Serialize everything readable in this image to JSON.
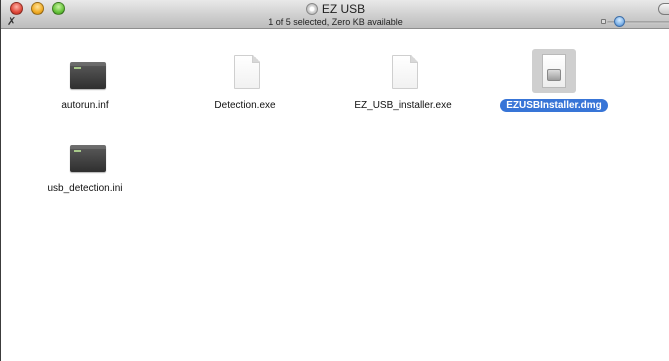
{
  "window": {
    "title": "EZ USB",
    "status": "1 of 5 selected, Zero KB available"
  },
  "icons": {
    "title_disk": "disk-icon",
    "toolbar_tool": "tool-icon"
  },
  "files": [
    {
      "name": "autorun.inf",
      "icon": "terminal-file-icon",
      "selected": false
    },
    {
      "name": "Detection.exe",
      "icon": "generic-document-icon",
      "selected": false
    },
    {
      "name": "EZ_USB_installer.exe",
      "icon": "generic-document-icon",
      "selected": false
    },
    {
      "name": "EZUSBInstaller.dmg",
      "icon": "disk-image-icon",
      "selected": true
    },
    {
      "name": "usb_detection.ini",
      "icon": "terminal-file-icon",
      "selected": false
    }
  ],
  "colors": {
    "selection": "#3875d7"
  }
}
